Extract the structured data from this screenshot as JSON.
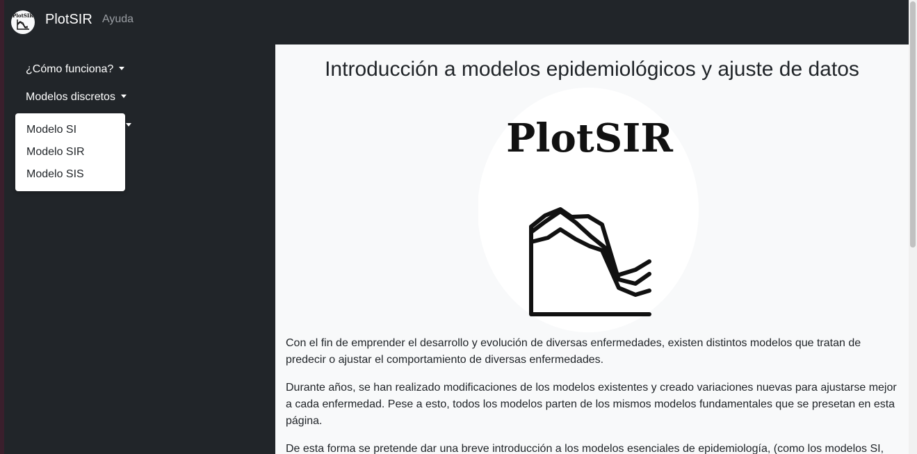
{
  "navbar": {
    "brand": "PlotSIR",
    "help_link": "Ayuda",
    "logo_text": "PlotSIR"
  },
  "sidebar": {
    "items": [
      {
        "label": "¿Cómo funciona?"
      },
      {
        "label": "Modelos discretos"
      }
    ],
    "dropdown": {
      "items": [
        "Modelo SI",
        "Modelo SIR",
        "Modelo SIS"
      ]
    }
  },
  "main": {
    "title": "Introducción a modelos epidemiológicos y ajuste de datos",
    "logo_text": "PlotSIR",
    "paragraphs": [
      "Con el fin de emprender el desarrollo y evolución de diversas enfermedades, existen distintos modelos que tratan de predecir o ajustar el comportamiento de diversas enfermedades.",
      "Durante años, se han realizado modificaciones de los modelos existentes y creado variaciones nuevas para ajustarse mejor a cada enfermedad. Pese a esto, todos los modelos parten de los mismos modelos fundamentales que se presetan en esta página.",
      "De esta forma se pretende dar una breve introducción a los modelos esenciales de epidemiología, (como los modelos SI,"
    ]
  },
  "colors": {
    "navbar_bg": "#212529",
    "content_bg": "#f8f9fa",
    "text": "#212529",
    "muted": "#9a9ea3"
  }
}
